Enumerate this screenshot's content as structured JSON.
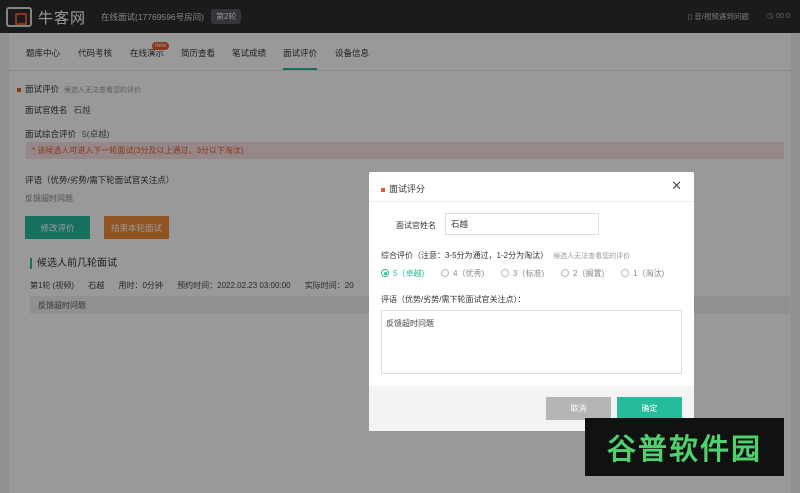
{
  "header": {
    "logo_text": "牛客网",
    "room": "在线面试(17769596号房间)",
    "round_badge": "第2轮",
    "report": "音/视频遇到问题",
    "clock": "00:0"
  },
  "tabs": [
    {
      "label": "题库中心"
    },
    {
      "label": "代码考核"
    },
    {
      "label": "在线演示",
      "badge": "new"
    },
    {
      "label": "简历查看"
    },
    {
      "label": "笔试成绩"
    },
    {
      "label": "面试评价",
      "active": true
    },
    {
      "label": "设备信息"
    }
  ],
  "evaluation": {
    "title": "面试评价",
    "hint": "候选人无法查看您的评价",
    "interviewer_label": "面试官姓名",
    "interviewer_name": "石越",
    "overall_label": "面试综合评价",
    "overall_value": "5(卓越)",
    "alert": "* 该候选人可进入下一轮面试(3分及以上通过，3分以下淘汰)",
    "comment_label": "评语（优势/劣势/需下轮面试官关注点）",
    "comment_value": "反馈超时问题",
    "edit_button": "修改评价",
    "end_button": "结束本轮面试"
  },
  "previous": {
    "title": "候选人前几轮面试",
    "round": "第1轮 (视频)",
    "interviewer": "石越",
    "used_time": "用时：0分钟",
    "scheduled_time": "预约时间：2022.02.23 03:00:00",
    "actual_time": "实际时间：20",
    "feedback": "反馈超时问题"
  },
  "modal": {
    "title": "面试评分",
    "name_label": "面试官姓名",
    "name_value": "石越",
    "overall_label": "综合评价（注意：3-5分为通过，1-2分为淘汰）",
    "overall_hint": "候选人无法查看您的评价",
    "options": [
      {
        "label": "5（卓越)",
        "checked": true
      },
      {
        "label": "4（优秀)"
      },
      {
        "label": "3（标准)"
      },
      {
        "label": "2（搁置)"
      },
      {
        "label": "1（淘汰)"
      }
    ],
    "comment_label": "评语（优势/劣势/需下轮面试官关注点）：",
    "comment_value": "反馈超时问题",
    "cancel": "取消",
    "confirm": "确定"
  },
  "watermark": "谷普软件园",
  "colors": {
    "accent": "#25bb9b",
    "brand": "#e8592c",
    "orange_button": "#f18b3a",
    "topbar": "#2b2d31"
  }
}
